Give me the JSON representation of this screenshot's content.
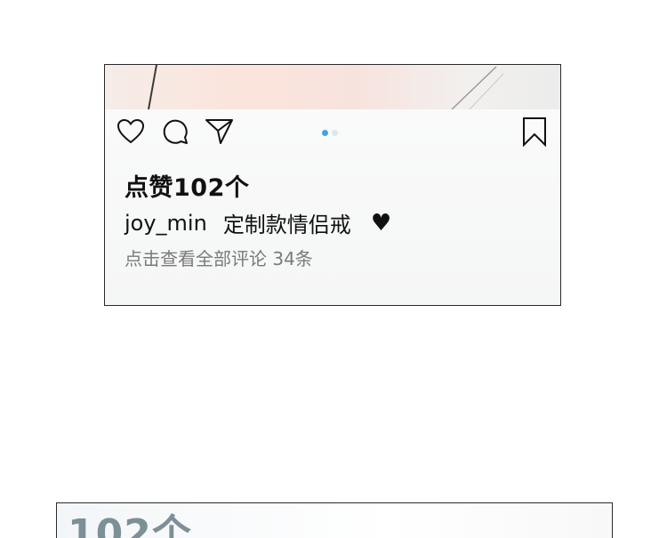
{
  "post": {
    "likes_text": "点赞102个",
    "username": "joy_min",
    "caption": "定制款情侣戒",
    "caption_emoji": "♥",
    "view_comments": "点击查看全部评论 34条",
    "carousel": {
      "total": 2,
      "active": 1
    },
    "icons": [
      "heart-icon",
      "comment-icon",
      "share-icon",
      "bookmark-icon"
    ],
    "colors": {
      "active_dot": "#3fa3e6",
      "inactive_dot": "#d9e8f3",
      "comment_text": "#7a7a7a"
    }
  },
  "next_panel": {
    "peek_text": "102个"
  }
}
